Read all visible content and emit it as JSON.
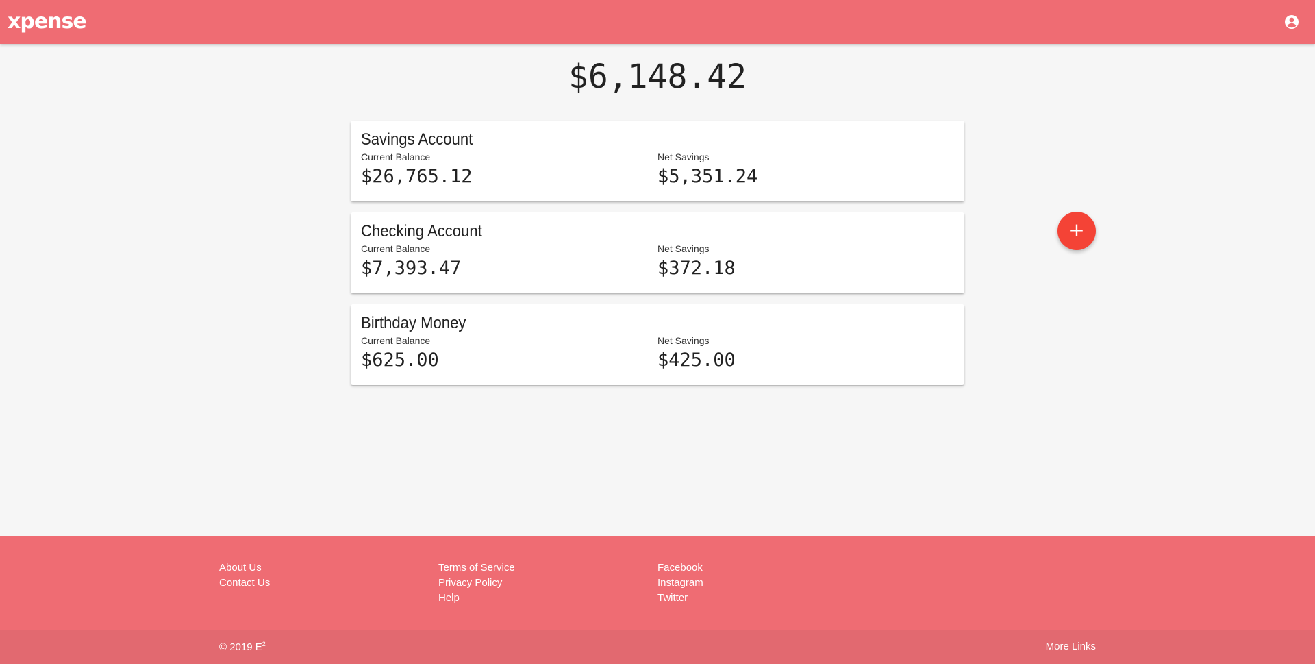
{
  "app": {
    "name": "xpense"
  },
  "total_balance": "$6,148.42",
  "accounts": [
    {
      "name": "Savings Account",
      "balance_label": "Current Balance",
      "balance": "$26,765.12",
      "savings_label": "Net Savings",
      "savings": "$5,351.24"
    },
    {
      "name": "Checking Account",
      "balance_label": "Current Balance",
      "balance": "$7,393.47",
      "savings_label": "Net Savings",
      "savings": "$372.18"
    },
    {
      "name": "Birthday Money",
      "balance_label": "Current Balance",
      "balance": "$625.00",
      "savings_label": "Net Savings",
      "savings": "$425.00"
    }
  ],
  "fab": {
    "icon": "plus-icon",
    "label": "+"
  },
  "footer": {
    "col1": [
      "About Us",
      "Contact Us"
    ],
    "col2": [
      "Terms of Service",
      "Privacy Policy",
      "Help"
    ],
    "col3": [
      "Facebook",
      "Instagram",
      "Twitter"
    ],
    "copyright": "© 2019 E",
    "copyright_sup": "2",
    "more_links": "More Links"
  },
  "colors": {
    "brand": "#ef6c73",
    "footer_bottom": "#e26970",
    "fab": "#f44336",
    "background": "#f6f6f6"
  }
}
